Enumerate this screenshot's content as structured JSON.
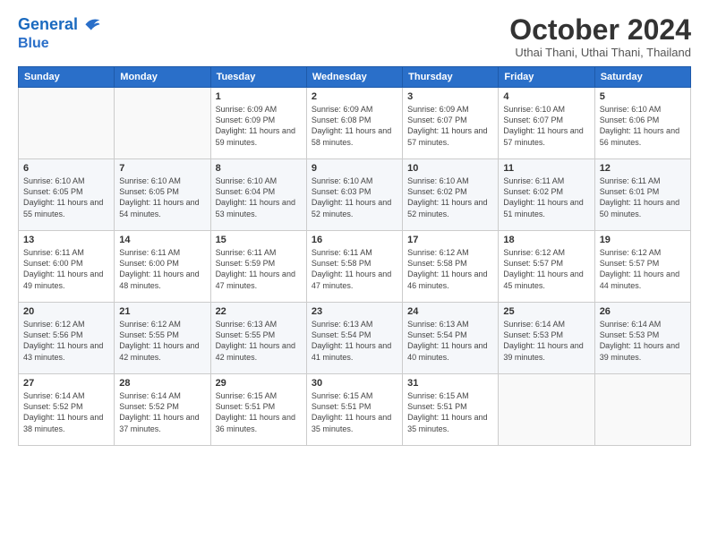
{
  "header": {
    "logo_line1": "General",
    "logo_line2": "Blue",
    "month_title": "October 2024",
    "subtitle": "Uthai Thani, Uthai Thani, Thailand"
  },
  "weekdays": [
    "Sunday",
    "Monday",
    "Tuesday",
    "Wednesday",
    "Thursday",
    "Friday",
    "Saturday"
  ],
  "weeks": [
    [
      {
        "day": "",
        "info": ""
      },
      {
        "day": "",
        "info": ""
      },
      {
        "day": "1",
        "info": "Sunrise: 6:09 AM\nSunset: 6:09 PM\nDaylight: 11 hours and 59 minutes."
      },
      {
        "day": "2",
        "info": "Sunrise: 6:09 AM\nSunset: 6:08 PM\nDaylight: 11 hours and 58 minutes."
      },
      {
        "day": "3",
        "info": "Sunrise: 6:09 AM\nSunset: 6:07 PM\nDaylight: 11 hours and 57 minutes."
      },
      {
        "day": "4",
        "info": "Sunrise: 6:10 AM\nSunset: 6:07 PM\nDaylight: 11 hours and 57 minutes."
      },
      {
        "day": "5",
        "info": "Sunrise: 6:10 AM\nSunset: 6:06 PM\nDaylight: 11 hours and 56 minutes."
      }
    ],
    [
      {
        "day": "6",
        "info": "Sunrise: 6:10 AM\nSunset: 6:05 PM\nDaylight: 11 hours and 55 minutes."
      },
      {
        "day": "7",
        "info": "Sunrise: 6:10 AM\nSunset: 6:05 PM\nDaylight: 11 hours and 54 minutes."
      },
      {
        "day": "8",
        "info": "Sunrise: 6:10 AM\nSunset: 6:04 PM\nDaylight: 11 hours and 53 minutes."
      },
      {
        "day": "9",
        "info": "Sunrise: 6:10 AM\nSunset: 6:03 PM\nDaylight: 11 hours and 52 minutes."
      },
      {
        "day": "10",
        "info": "Sunrise: 6:10 AM\nSunset: 6:02 PM\nDaylight: 11 hours and 52 minutes."
      },
      {
        "day": "11",
        "info": "Sunrise: 6:11 AM\nSunset: 6:02 PM\nDaylight: 11 hours and 51 minutes."
      },
      {
        "day": "12",
        "info": "Sunrise: 6:11 AM\nSunset: 6:01 PM\nDaylight: 11 hours and 50 minutes."
      }
    ],
    [
      {
        "day": "13",
        "info": "Sunrise: 6:11 AM\nSunset: 6:00 PM\nDaylight: 11 hours and 49 minutes."
      },
      {
        "day": "14",
        "info": "Sunrise: 6:11 AM\nSunset: 6:00 PM\nDaylight: 11 hours and 48 minutes."
      },
      {
        "day": "15",
        "info": "Sunrise: 6:11 AM\nSunset: 5:59 PM\nDaylight: 11 hours and 47 minutes."
      },
      {
        "day": "16",
        "info": "Sunrise: 6:11 AM\nSunset: 5:58 PM\nDaylight: 11 hours and 47 minutes."
      },
      {
        "day": "17",
        "info": "Sunrise: 6:12 AM\nSunset: 5:58 PM\nDaylight: 11 hours and 46 minutes."
      },
      {
        "day": "18",
        "info": "Sunrise: 6:12 AM\nSunset: 5:57 PM\nDaylight: 11 hours and 45 minutes."
      },
      {
        "day": "19",
        "info": "Sunrise: 6:12 AM\nSunset: 5:57 PM\nDaylight: 11 hours and 44 minutes."
      }
    ],
    [
      {
        "day": "20",
        "info": "Sunrise: 6:12 AM\nSunset: 5:56 PM\nDaylight: 11 hours and 43 minutes."
      },
      {
        "day": "21",
        "info": "Sunrise: 6:12 AM\nSunset: 5:55 PM\nDaylight: 11 hours and 42 minutes."
      },
      {
        "day": "22",
        "info": "Sunrise: 6:13 AM\nSunset: 5:55 PM\nDaylight: 11 hours and 42 minutes."
      },
      {
        "day": "23",
        "info": "Sunrise: 6:13 AM\nSunset: 5:54 PM\nDaylight: 11 hours and 41 minutes."
      },
      {
        "day": "24",
        "info": "Sunrise: 6:13 AM\nSunset: 5:54 PM\nDaylight: 11 hours and 40 minutes."
      },
      {
        "day": "25",
        "info": "Sunrise: 6:14 AM\nSunset: 5:53 PM\nDaylight: 11 hours and 39 minutes."
      },
      {
        "day": "26",
        "info": "Sunrise: 6:14 AM\nSunset: 5:53 PM\nDaylight: 11 hours and 39 minutes."
      }
    ],
    [
      {
        "day": "27",
        "info": "Sunrise: 6:14 AM\nSunset: 5:52 PM\nDaylight: 11 hours and 38 minutes."
      },
      {
        "day": "28",
        "info": "Sunrise: 6:14 AM\nSunset: 5:52 PM\nDaylight: 11 hours and 37 minutes."
      },
      {
        "day": "29",
        "info": "Sunrise: 6:15 AM\nSunset: 5:51 PM\nDaylight: 11 hours and 36 minutes."
      },
      {
        "day": "30",
        "info": "Sunrise: 6:15 AM\nSunset: 5:51 PM\nDaylight: 11 hours and 35 minutes."
      },
      {
        "day": "31",
        "info": "Sunrise: 6:15 AM\nSunset: 5:51 PM\nDaylight: 11 hours and 35 minutes."
      },
      {
        "day": "",
        "info": ""
      },
      {
        "day": "",
        "info": ""
      }
    ]
  ]
}
